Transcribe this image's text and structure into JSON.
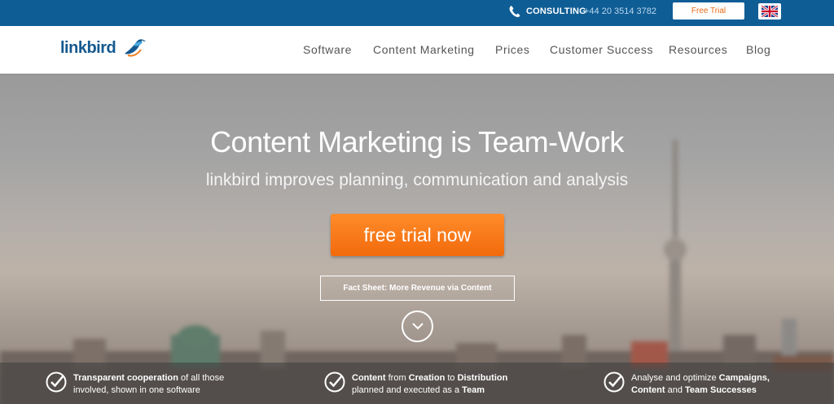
{
  "topbar": {
    "consulting_label": "CONSULTING",
    "phone_number": "+44 20 3514 3782",
    "free_trial_label": "Free Trial",
    "language_icon": "uk-flag-icon"
  },
  "logo": {
    "text": "linkbird",
    "icon": "bird-icon"
  },
  "nav": {
    "items": [
      {
        "label": "Software"
      },
      {
        "label": "Content Marketing"
      },
      {
        "label": "Prices"
      },
      {
        "label": "Customer Success"
      },
      {
        "label": "Resources"
      },
      {
        "label": "Blog"
      }
    ]
  },
  "hero": {
    "title": "Content Marketing is Team-Work",
    "subtitle": "linkbird improves planning, communication and analysis",
    "cta_label": "free trial now",
    "factsheet_label": "Fact Sheet: More Revenue via Content",
    "scroll_icon": "chevron-down-icon"
  },
  "features": [
    {
      "parts": [
        {
          "t": "Transparent cooperation",
          "b": true
        },
        {
          "t": " of all those involved, shown in one software",
          "b": false
        }
      ]
    },
    {
      "parts": [
        {
          "t": "Content",
          "b": true
        },
        {
          "t": " from ",
          "b": false
        },
        {
          "t": "Creation",
          "b": true
        },
        {
          "t": " to ",
          "b": false
        },
        {
          "t": "Distribution",
          "b": true
        },
        {
          "t": " planned and executed as a ",
          "b": false
        },
        {
          "t": "Team",
          "b": true
        }
      ]
    },
    {
      "parts": [
        {
          "t": "Analyse and optimize ",
          "b": false
        },
        {
          "t": "Campaigns, Content",
          "b": true
        },
        {
          "t": " and ",
          "b": false
        },
        {
          "t": "Team Successes",
          "b": true
        }
      ]
    }
  ],
  "colors": {
    "topbar_bg": "#0f5d95",
    "brand_blue": "#14598f",
    "cta_orange": "#f26a0c"
  }
}
